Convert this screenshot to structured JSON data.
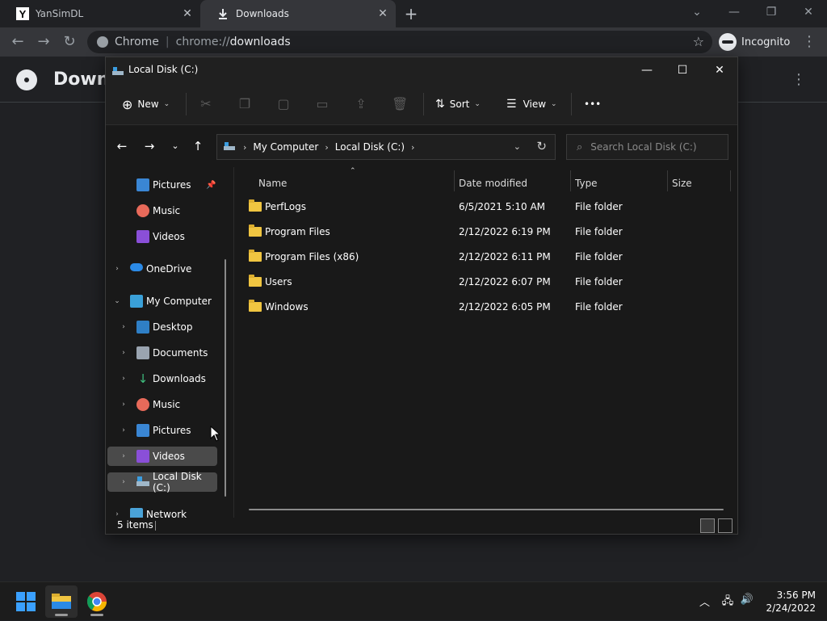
{
  "chrome": {
    "tabs": [
      {
        "title": "YanSimDL",
        "favicon": "y-icon"
      },
      {
        "title": "Downloads",
        "favicon": "download-icon"
      }
    ],
    "new_tab_label": "+",
    "omnibox": {
      "site_label": "Chrome",
      "url_scheme": "chrome://",
      "url_path": "downloads"
    },
    "profile_label": "Incognito",
    "page_title": "Downl"
  },
  "explorer": {
    "title": "Local Disk (C:)",
    "commands": {
      "new": "New",
      "sort": "Sort",
      "view": "View",
      "more": "•••"
    },
    "address": {
      "crumbs": [
        "My Computer",
        "Local Disk (C:)"
      ]
    },
    "search_placeholder": "Search Local Disk (C:)",
    "nav": [
      {
        "label": "Pictures",
        "icon": "pictures-icon",
        "pinned": true
      },
      {
        "label": "Music",
        "icon": "music-icon"
      },
      {
        "label": "Videos",
        "icon": "videos-icon"
      },
      {
        "label": "OneDrive",
        "icon": "onedrive-icon"
      },
      {
        "label": "My Computer",
        "icon": "computer-icon"
      },
      {
        "label": "Desktop",
        "icon": "desktop-icon"
      },
      {
        "label": "Documents",
        "icon": "documents-icon"
      },
      {
        "label": "Downloads",
        "icon": "downloads-icon"
      },
      {
        "label": "Music",
        "icon": "music-icon"
      },
      {
        "label": "Pictures",
        "icon": "pictures-icon"
      },
      {
        "label": "Videos",
        "icon": "videos-icon"
      },
      {
        "label": "Local Disk (C:)",
        "icon": "drive-icon"
      },
      {
        "label": "Network",
        "icon": "network-icon"
      }
    ],
    "columns": {
      "name": "Name",
      "date": "Date modified",
      "type": "Type",
      "size": "Size"
    },
    "rows": [
      {
        "name": "PerfLogs",
        "date": "6/5/2021 5:10 AM",
        "type": "File folder"
      },
      {
        "name": "Program Files",
        "date": "2/12/2022 6:19 PM",
        "type": "File folder"
      },
      {
        "name": "Program Files (x86)",
        "date": "2/12/2022 6:11 PM",
        "type": "File folder"
      },
      {
        "name": "Users",
        "date": "2/12/2022 6:07 PM",
        "type": "File folder"
      },
      {
        "name": "Windows",
        "date": "2/12/2022 6:05 PM",
        "type": "File folder"
      }
    ],
    "status": "5 items"
  },
  "taskbar": {
    "time": "3:56 PM",
    "date": "2/24/2022"
  },
  "colors": {
    "folder": "#f0c541",
    "accent": "#0078d4"
  }
}
